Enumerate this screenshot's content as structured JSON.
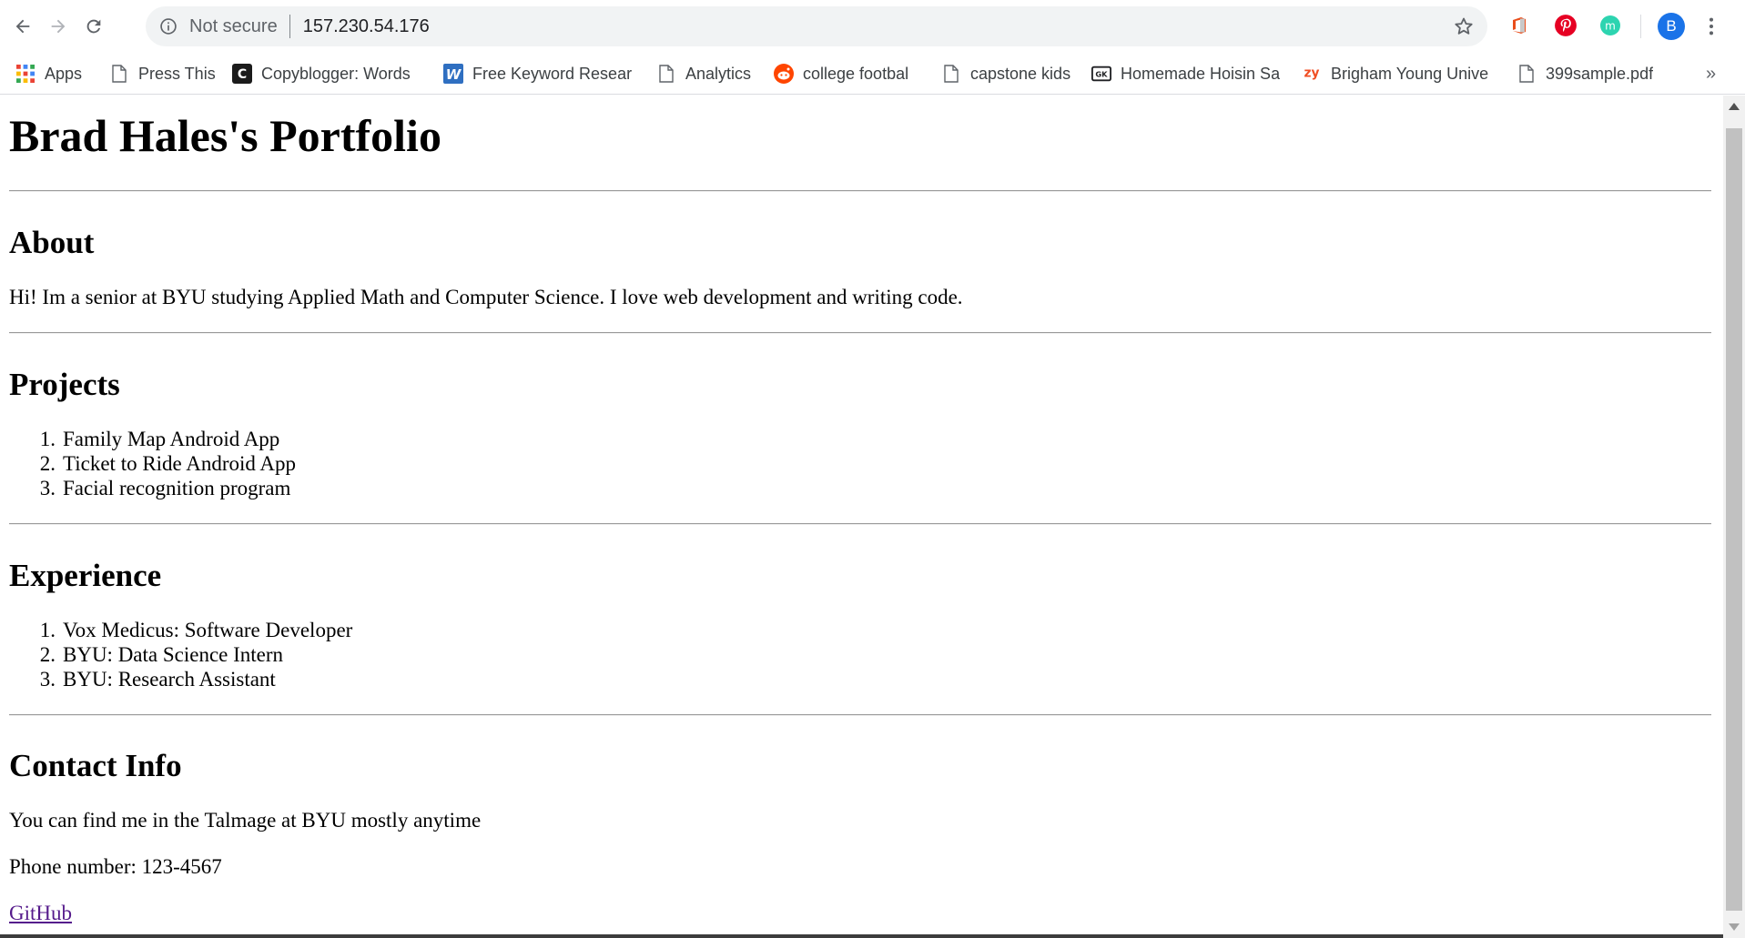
{
  "browser": {
    "security_label": "Not secure",
    "url": "157.230.54.176",
    "profile_initial": "B"
  },
  "bookmarks": [
    {
      "label": "Apps",
      "icon": "apps-grid-icon"
    },
    {
      "label": "Press This",
      "icon": "page-icon"
    },
    {
      "label": "Copyblogger: Words",
      "icon": "copyblogger-icon"
    },
    {
      "label": "Free Keyword Resear",
      "icon": "w-logo-icon"
    },
    {
      "label": "Analytics",
      "icon": "page-icon"
    },
    {
      "label": "college footbal",
      "icon": "reddit-icon"
    },
    {
      "label": "capstone kids",
      "icon": "page-icon"
    },
    {
      "label": "Homemade Hoisin Sa",
      "icon": "gk-icon"
    },
    {
      "label": "Brigham Young Unive",
      "icon": "zy-icon"
    },
    {
      "label": "399sample.pdf",
      "icon": "page-icon"
    }
  ],
  "page": {
    "title": "Brad Hales's Portfolio",
    "about": {
      "heading": "About",
      "text": "Hi! Im a senior at BYU studying Applied Math and Computer Science. I love web development and writing code."
    },
    "projects": {
      "heading": "Projects",
      "items": [
        "Family Map Android App",
        "Ticket to Ride Android App",
        "Facial recognition program"
      ]
    },
    "experience": {
      "heading": "Experience",
      "items": [
        "Vox Medicus: Software Developer",
        "BYU: Data Science Intern",
        "BYU: Research Assistant"
      ]
    },
    "contact": {
      "heading": "Contact Info",
      "location": "You can find me in the Talmage at BYU mostly anytime",
      "phone": "Phone number: 123-4567",
      "github": "GitHub"
    }
  },
  "colors": {
    "link_visited": "#551a8b",
    "accent": "#1a73e8"
  }
}
